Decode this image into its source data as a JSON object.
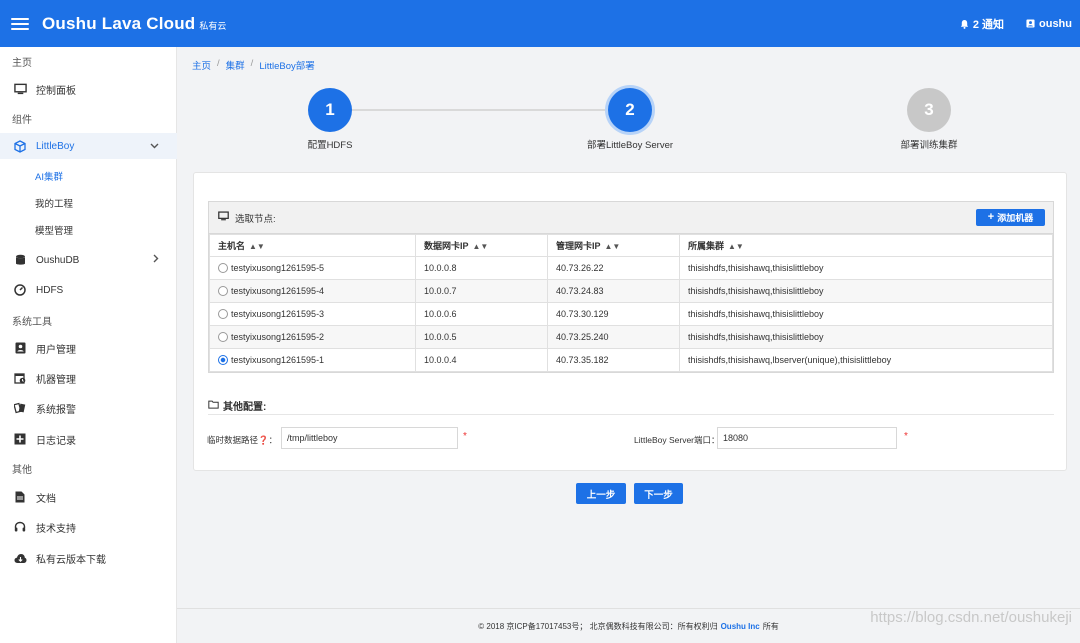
{
  "topbar": {
    "brand": "Oushu Lava Cloud",
    "brand_sub": "私有云",
    "notify": "2 通知",
    "user": "oushu"
  },
  "sidebar": {
    "group_home": "主页",
    "dashboard": "控制面板",
    "group_components": "组件",
    "littleboy": "LittleBoy",
    "ai_cluster": "AI集群",
    "my_projects": "我的工程",
    "model_mgmt": "模型管理",
    "oushudb": "OushuDB",
    "hdfs": "HDFS",
    "group_tools": "系统工具",
    "user_mgmt": "用户管理",
    "machine_mgmt": "机器管理",
    "alerts": "系统报警",
    "logs": "日志记录",
    "group_other": "其他",
    "docs": "文档",
    "support": "技术支持",
    "download": "私有云版本下载"
  },
  "breadcrumb": {
    "home": "主页",
    "cluster": "集群",
    "current": "LittleBoy部署"
  },
  "steps": [
    {
      "num": "1",
      "label": "配置HDFS"
    },
    {
      "num": "2",
      "label": "部署LittleBoy Server"
    },
    {
      "num": "3",
      "label": "部署训练集群"
    }
  ],
  "nodes_panel": {
    "title": "选取节点:",
    "add_button": "添加机器",
    "columns": [
      "主机名",
      "数据网卡IP",
      "管理网卡IP",
      "所属集群"
    ],
    "rows": [
      {
        "host": "testyixusong1261595-5",
        "data_ip": "10.0.0.8",
        "mgmt_ip": "40.73.26.22",
        "cluster": "thisishdfs,thisishawq,thisislittleboy"
      },
      {
        "host": "testyixusong1261595-4",
        "data_ip": "10.0.0.7",
        "mgmt_ip": "40.73.24.83",
        "cluster": "thisishdfs,thisishawq,thisislittleboy"
      },
      {
        "host": "testyixusong1261595-3",
        "data_ip": "10.0.0.6",
        "mgmt_ip": "40.73.30.129",
        "cluster": "thisishdfs,thisishawq,thisislittleboy"
      },
      {
        "host": "testyixusong1261595-2",
        "data_ip": "10.0.0.5",
        "mgmt_ip": "40.73.25.240",
        "cluster": "thisishdfs,thisishawq,thisislittleboy"
      },
      {
        "host": "testyixusong1261595-1",
        "data_ip": "10.0.0.4",
        "mgmt_ip": "40.73.35.182",
        "cluster": "thisishdfs,thisishawq,lbserver(unique),thisislittleboy"
      }
    ]
  },
  "other_config": {
    "title": "其他配置:",
    "tmp_path_label": "临时数据路径❓：",
    "tmp_path_value": "/tmp/littleboy",
    "port_label": "LittleBoy Server端口：",
    "port_value": "18080",
    "required_mark": "*"
  },
  "actions": {
    "prev": "上一步",
    "next": "下一步"
  },
  "footer": {
    "text": "© 2018 京ICP备17017453号； 北京偶数科技有限公司：所有权利归",
    "brand": "Oushu Inc",
    "tail": "所有"
  },
  "watermark": "https://blog.csdn.net/oushukeji",
  "colors": {
    "primary": "#1d71e6",
    "step_inactive": "#c8c8c8"
  }
}
